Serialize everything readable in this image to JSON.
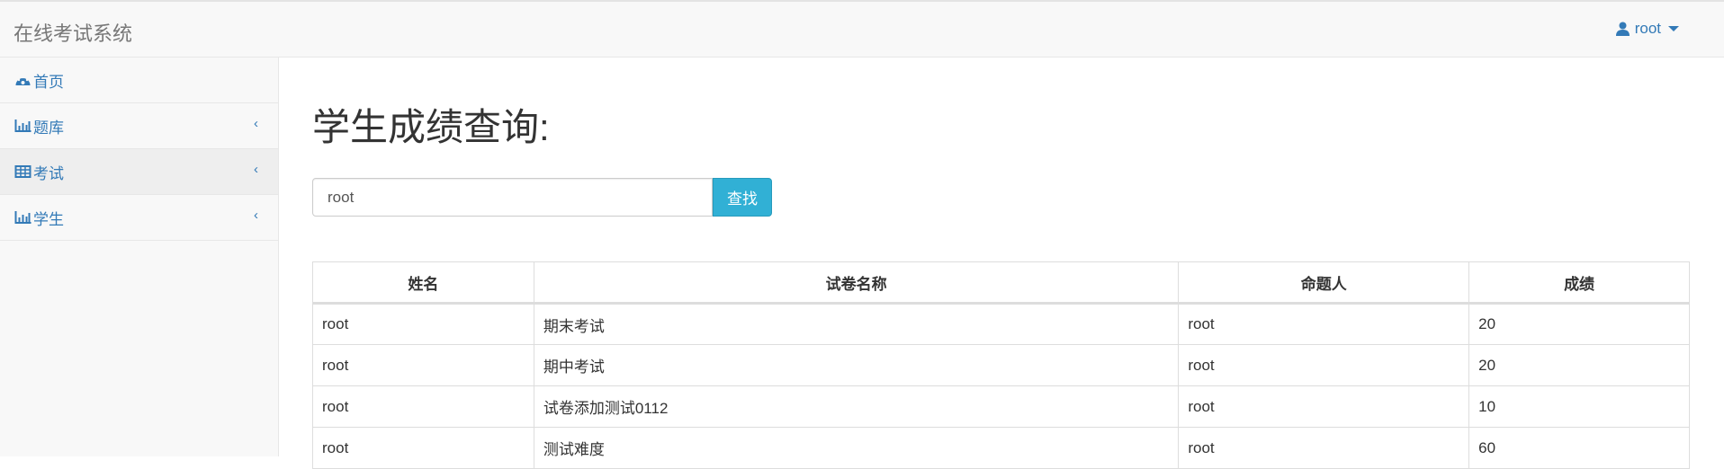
{
  "navbar": {
    "brand": "在线考试系统",
    "user": "root",
    "user_icon": "user-icon"
  },
  "sidebar": {
    "items": [
      {
        "label": "首页",
        "icon": "dashboard-icon"
      },
      {
        "label": "题库",
        "icon": "bar-chart-icon",
        "chevron": "‹"
      },
      {
        "label": "考试",
        "icon": "table-icon",
        "chevron": "‹"
      },
      {
        "label": "学生",
        "icon": "bar-chart-icon",
        "chevron": "‹"
      }
    ]
  },
  "main": {
    "title": "学生成绩查询:",
    "search": {
      "value": "root",
      "button": "查找"
    },
    "table": {
      "headers": [
        "姓名",
        "试卷名称",
        "命题人",
        "成绩"
      ],
      "rows": [
        [
          "root",
          "期末考试",
          "root",
          "20"
        ],
        [
          "root",
          "期中考试",
          "root",
          "20"
        ],
        [
          "root",
          "试卷添加测试0112",
          "root",
          "10"
        ],
        [
          "root",
          "测试难度",
          "root",
          "60"
        ]
      ]
    }
  },
  "colors": {
    "accent": "#337ab7",
    "button": "#31b0d5"
  }
}
